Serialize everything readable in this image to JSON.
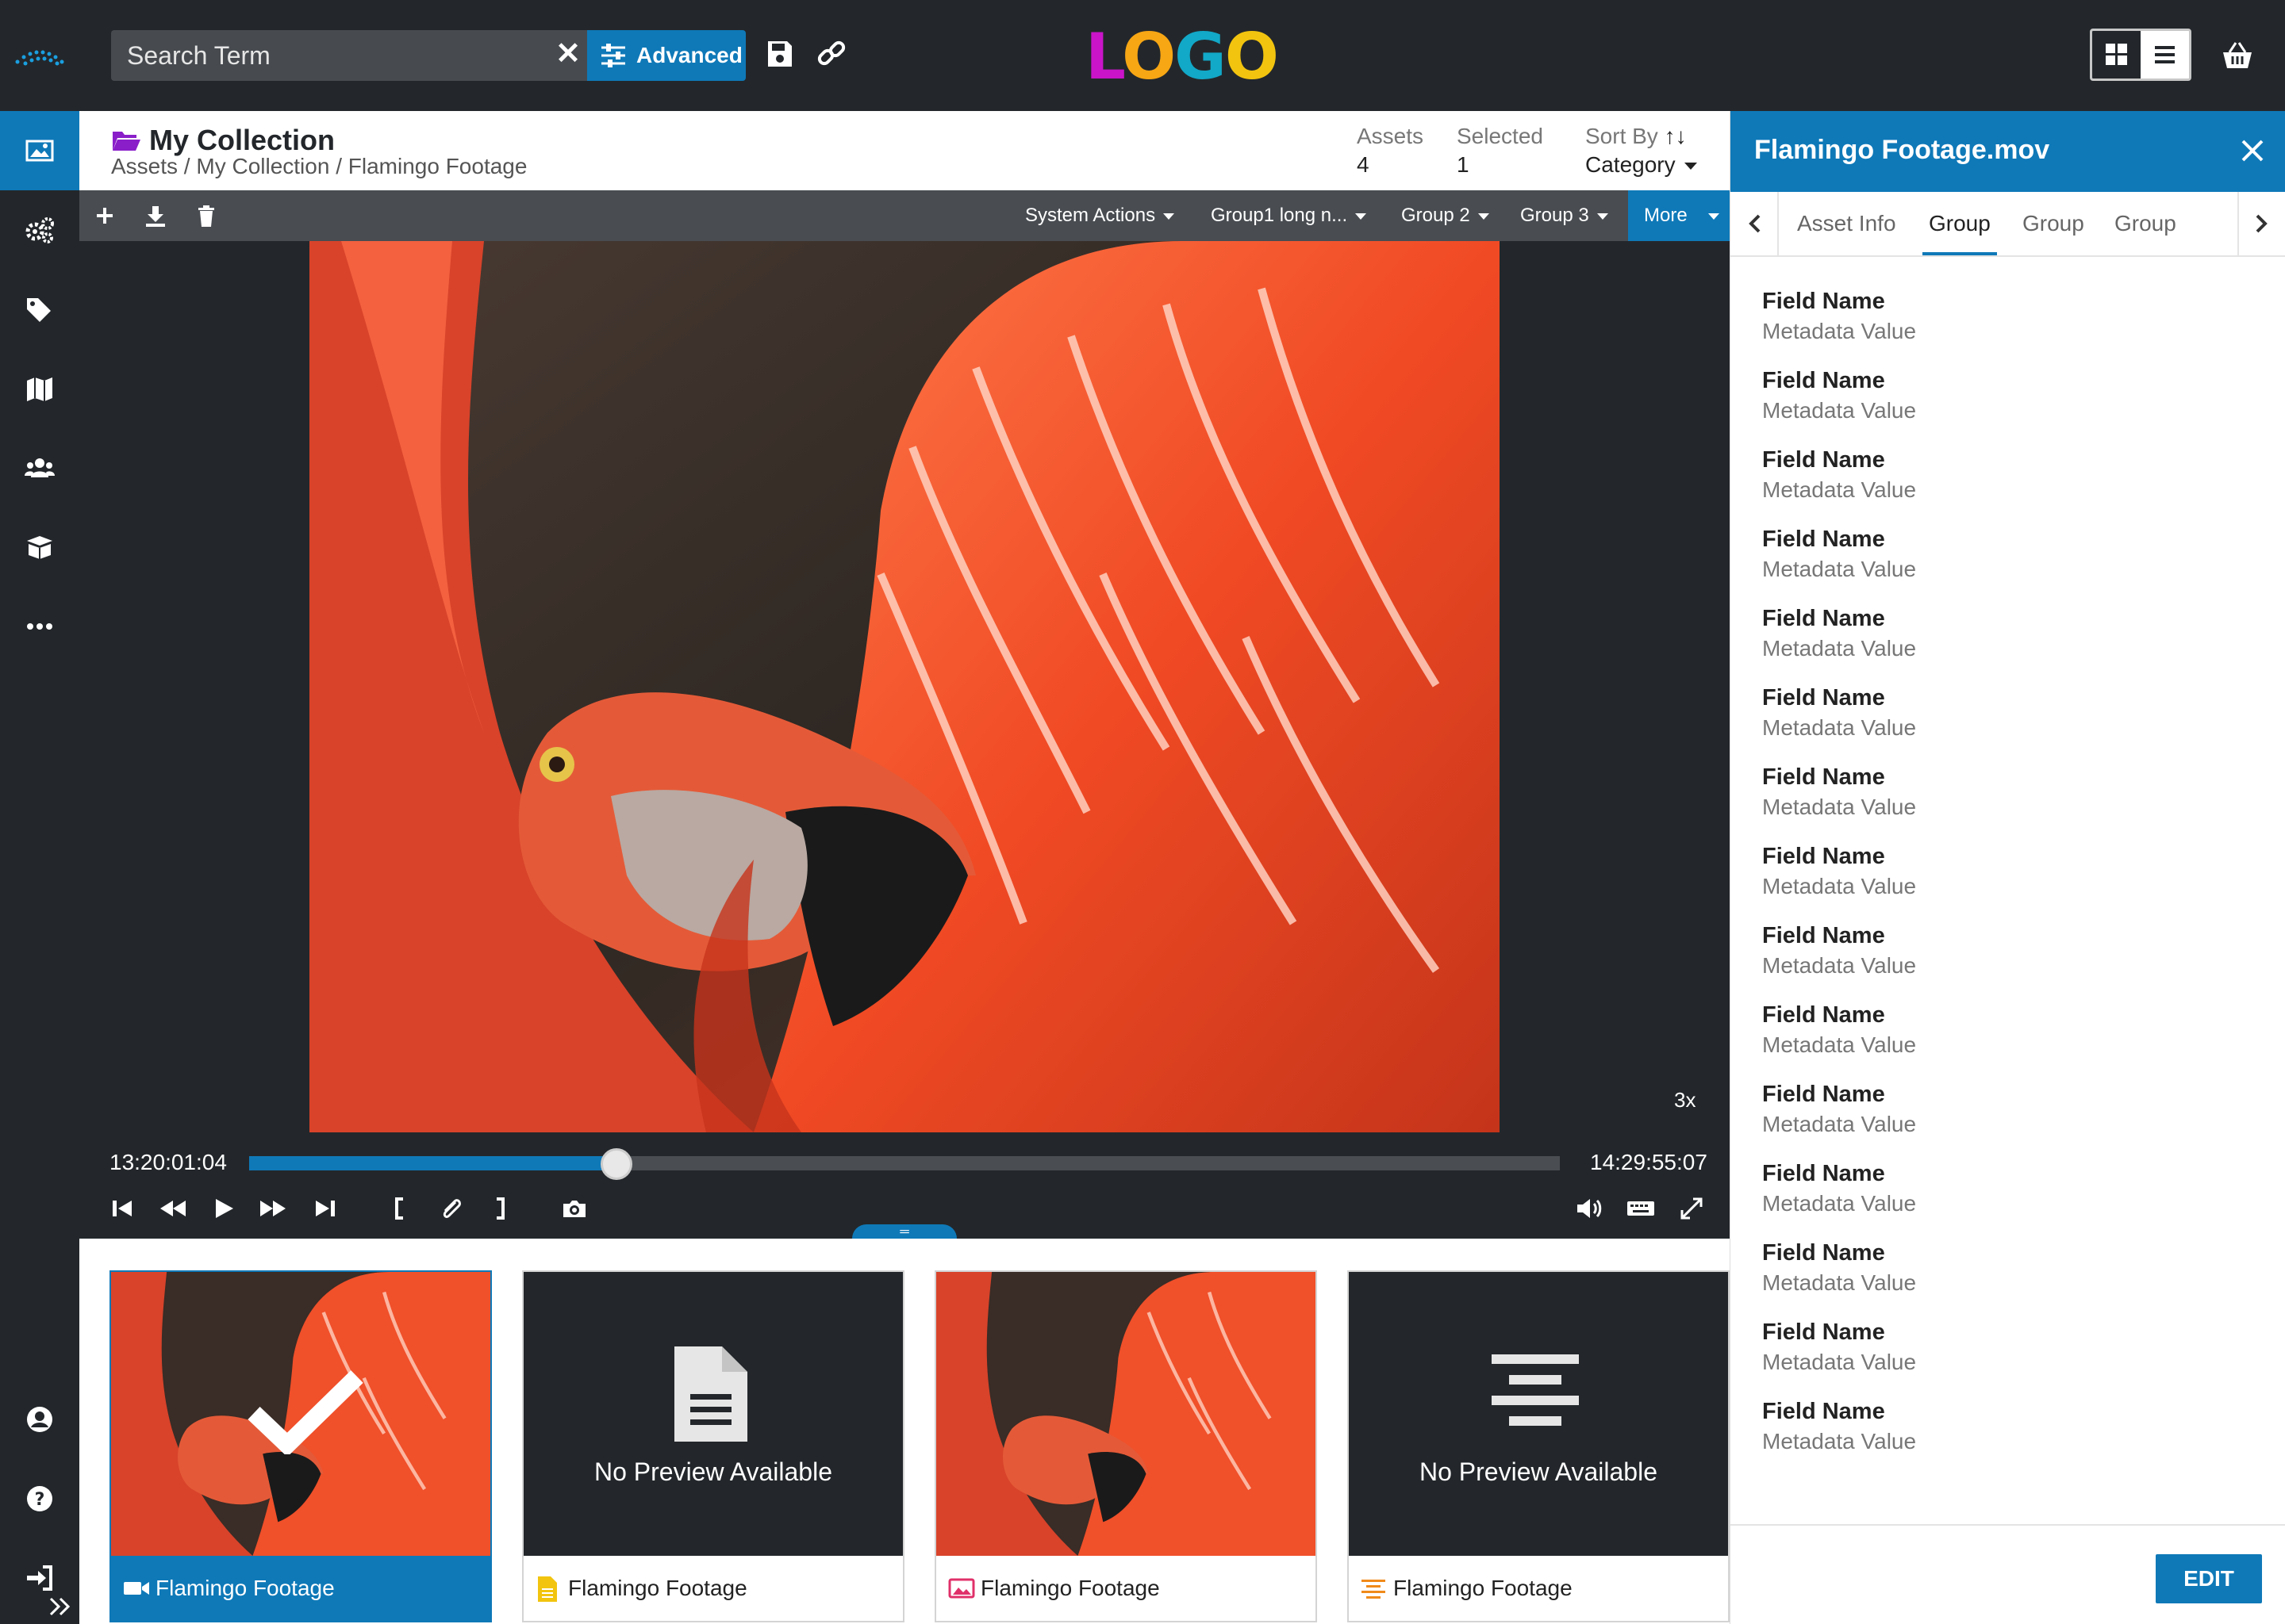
{
  "header": {
    "search_value": "Search Term",
    "advanced_label": "Advanced",
    "logo_text": "LOGO",
    "logo_colors": [
      "#c914c9",
      "#f7a614",
      "#12a8c8",
      "#f2c40f"
    ]
  },
  "collection": {
    "title": "My Collection",
    "breadcrumb": "Assets / My Collection / Flamingo Footage",
    "assets_label": "Assets",
    "assets_value": "4",
    "selected_label": "Selected",
    "selected_value": "1",
    "sort_label": "Sort By",
    "sort_value": "Category"
  },
  "toolbar": {
    "dropdowns": [
      "System Actions",
      "Group1 long n...",
      "Group 2",
      "Group 3"
    ],
    "more_label": "More"
  },
  "player": {
    "current_time": "13:20:01:04",
    "end_time": "14:29:55:07",
    "zoom": "3x",
    "progress": 0.28
  },
  "thumbnails": [
    {
      "caption": "Flamingo Footage",
      "type": "video",
      "preview": "image",
      "selected": true
    },
    {
      "caption": "Flamingo Footage",
      "type": "document",
      "preview": "none",
      "no_preview_text": "No Preview Available"
    },
    {
      "caption": "Flamingo Footage",
      "type": "image",
      "preview": "image"
    },
    {
      "caption": "Flamingo Footage",
      "type": "text",
      "preview": "none",
      "no_preview_text": "No Preview Available"
    }
  ],
  "right_panel": {
    "title": "Flamingo Footage.mov",
    "tabs": [
      "Asset Info",
      "Group",
      "Group",
      "Group"
    ],
    "active_tab": 1,
    "field_label": "Field Name",
    "field_value": "Metadata Value",
    "edit_label": "EDIT"
  },
  "colors": {
    "accent": "#0f79b8",
    "dark": "#23272b"
  }
}
